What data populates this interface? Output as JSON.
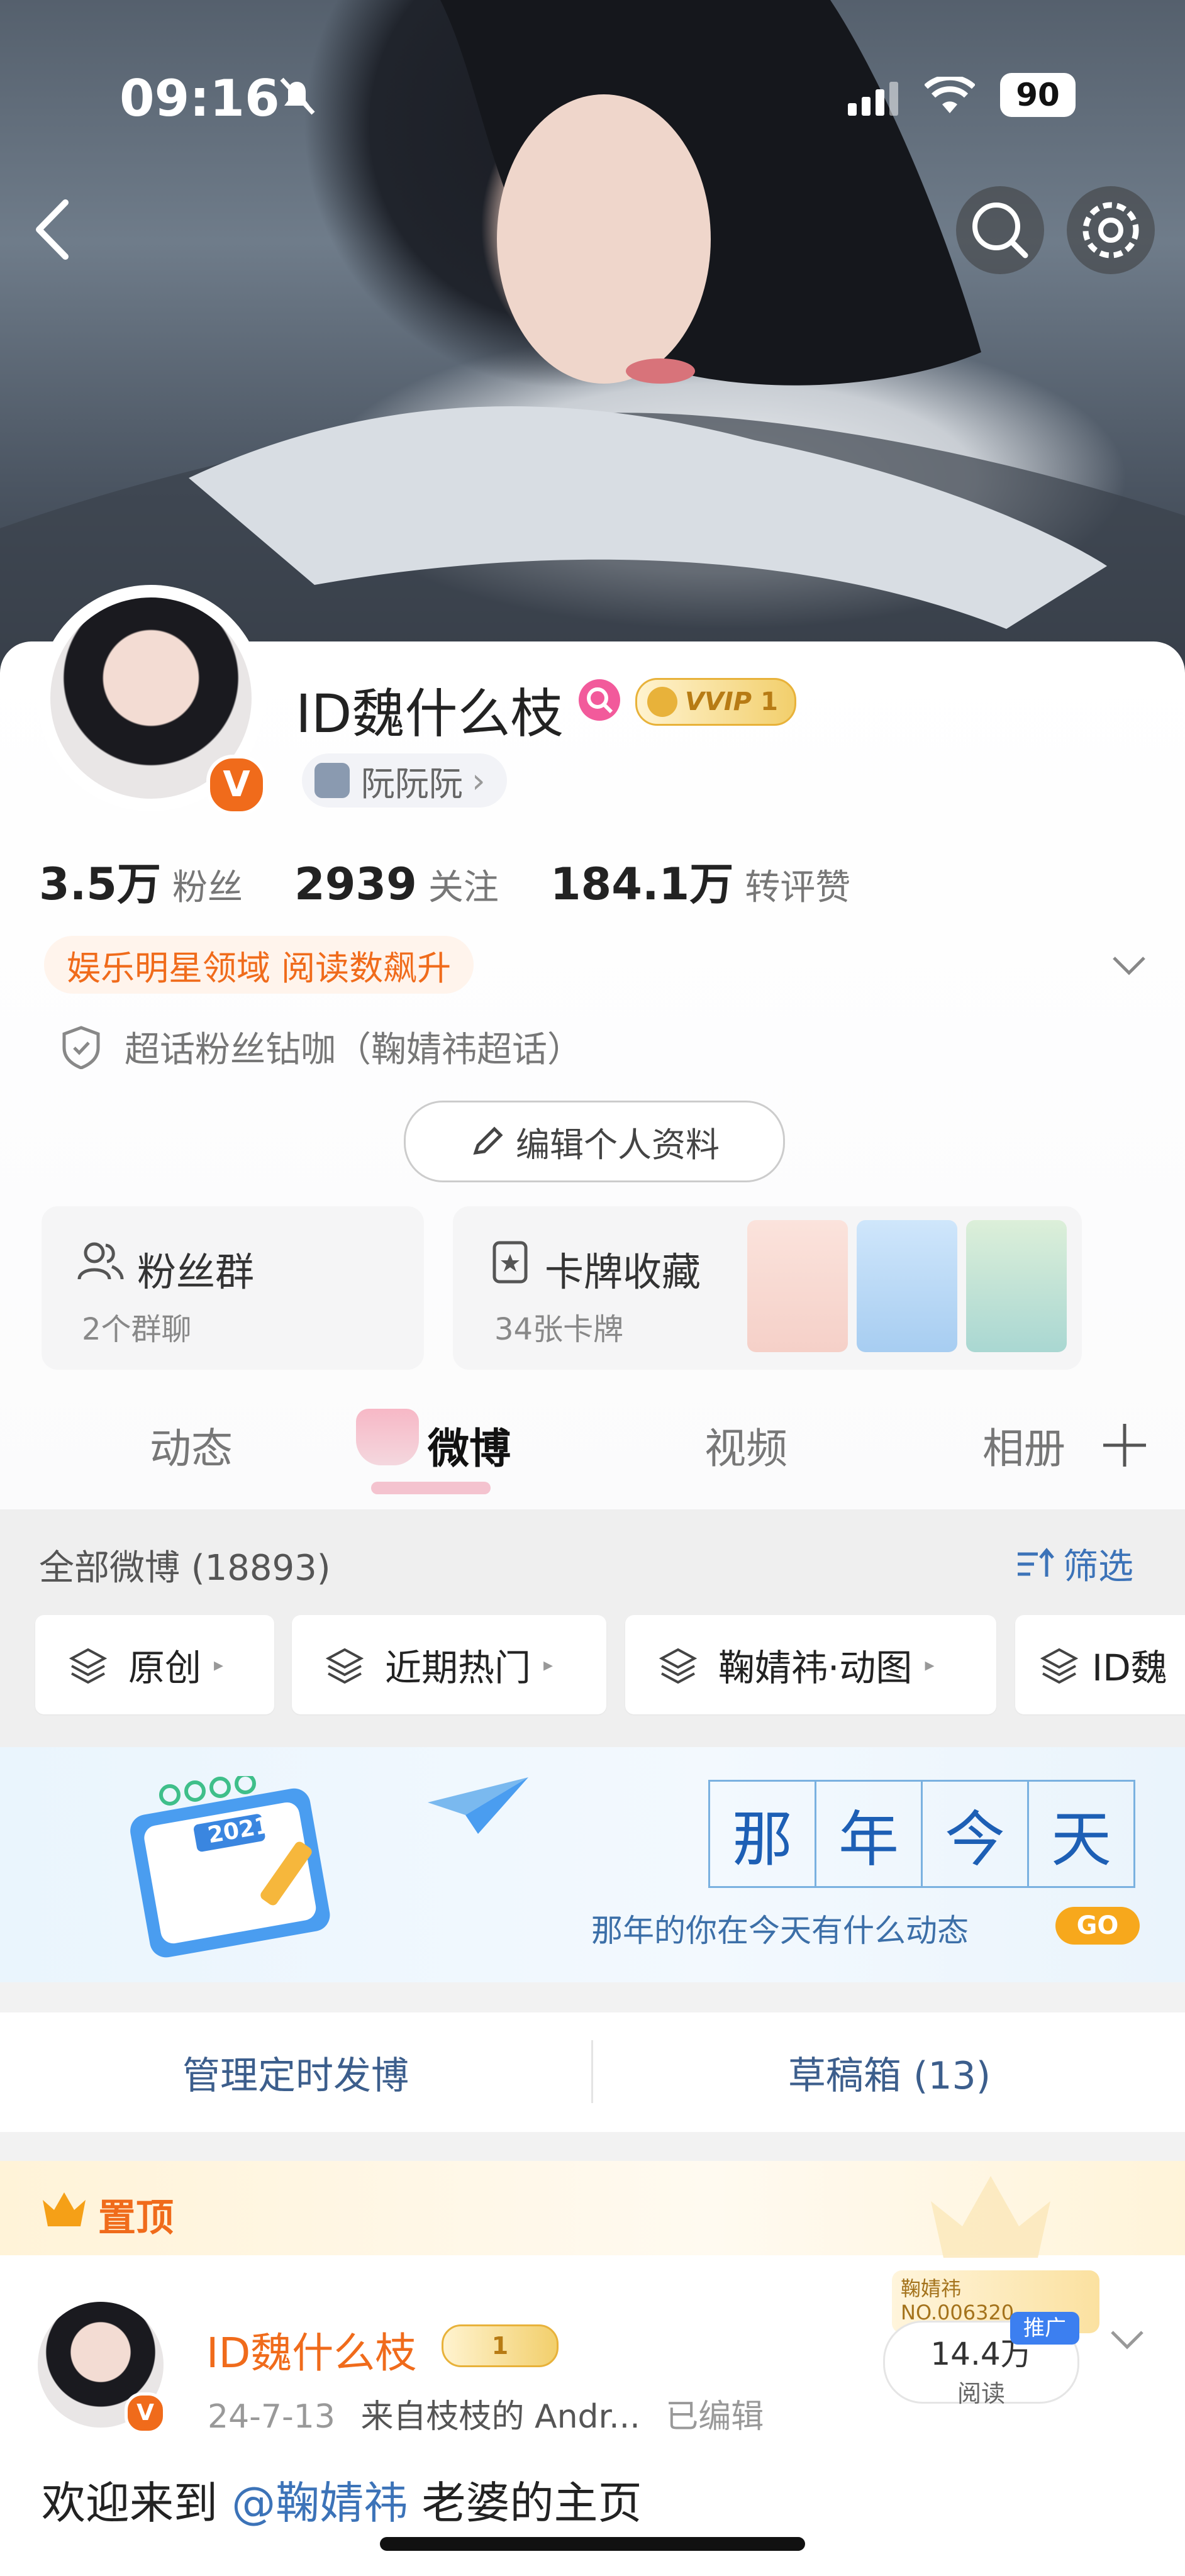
{
  "status_bar": {
    "time": "09:16",
    "battery": "90"
  },
  "profile": {
    "name": "ID魏什么枝",
    "vip_badge": "VVIP",
    "vip_level": "1",
    "fan_title": "阮阮阮",
    "stats": [
      {
        "value": "3.5万",
        "label": "粉丝"
      },
      {
        "value": "2939",
        "label": "关注"
      },
      {
        "value": "184.1万",
        "label": "转评赞"
      }
    ],
    "domain_tag": "娱乐明星领域 阅读数飙升",
    "super_topic": "超话粉丝钻咖（鞠婧祎超话）",
    "edit_button": "编辑个人资料"
  },
  "tiles": {
    "fans_group": {
      "title": "粉丝群",
      "sub": "2个群聊"
    },
    "cards": {
      "title": "卡牌收藏",
      "sub": "34张卡牌"
    }
  },
  "tabs": [
    "动态",
    "微博",
    "视频",
    "相册"
  ],
  "filter": {
    "all": "全部微博 (18893)",
    "filter_label": "筛选"
  },
  "chips": [
    "原创",
    "近期热门",
    "鞠婧祎·动图",
    "ID魏"
  ],
  "banner": {
    "chars": [
      "那",
      "年",
      "今",
      "天"
    ],
    "sub": "那年的你在今天有什么动态",
    "go": "GO",
    "calendar_year": "2021"
  },
  "actions": {
    "scheduled": "管理定时发博",
    "drafts": "草稿箱 (13)"
  },
  "pinned": {
    "label": "置顶",
    "author": "ID魏什么枝",
    "date": "24-7-13",
    "source": "来自枝枝的 Andr...",
    "edited": "已编辑",
    "reads_value": "14.4万",
    "reads_label": "阅读",
    "promo": "推广",
    "promo_name": "鞠婧祎",
    "promo_no": "NO.006320",
    "text_prefix": "欢迎来到",
    "text_mention": "@鞠婧祎",
    "text_suffix": "老婆的主页"
  },
  "colors": {
    "accent_orange": "#f06b1b",
    "link_blue": "#3c73b8",
    "vip_gold": "#e8b23a"
  }
}
